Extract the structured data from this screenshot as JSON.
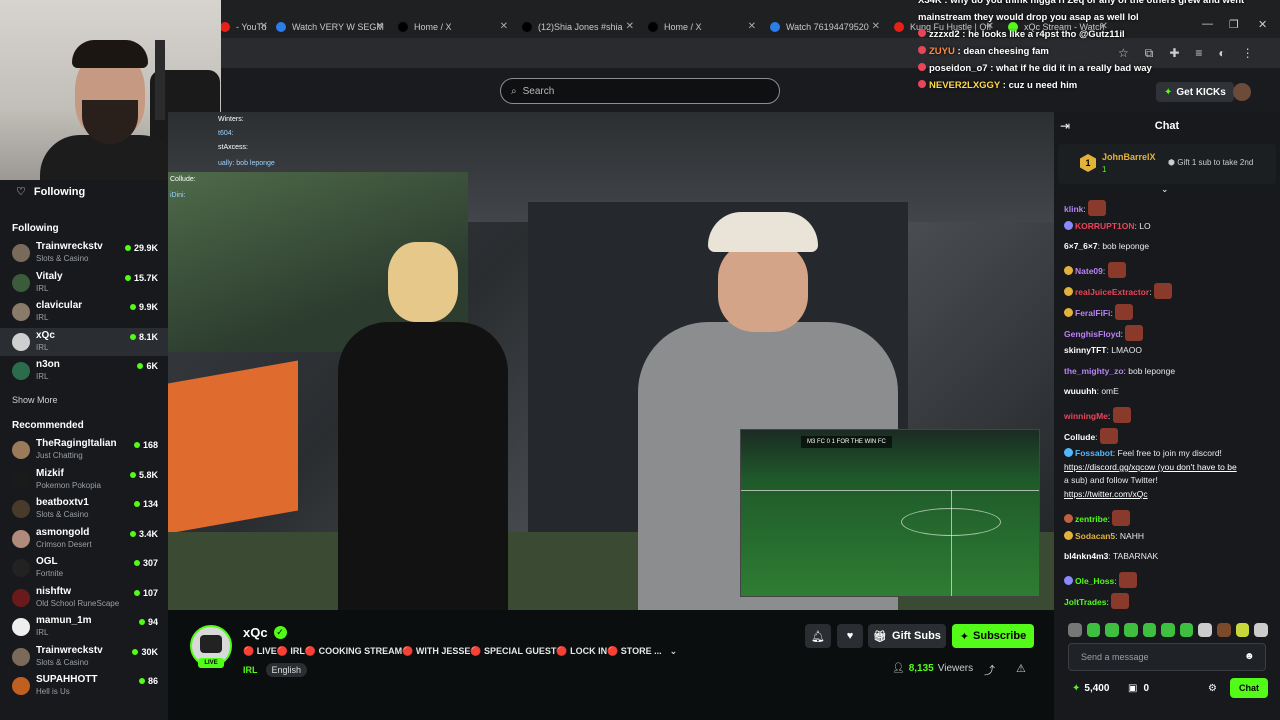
{
  "browser": {
    "tabs": [
      {
        "label": "- YouTu",
        "icon": "youtube-icon",
        "color": "#e62117"
      },
      {
        "label": "Watch VERY W SEGM",
        "icon": "site-icon",
        "color": "#2b7de9"
      },
      {
        "label": "Home / X",
        "icon": "x-icon",
        "color": "#000000"
      },
      {
        "label": "(12)Shia Jones #shia",
        "icon": "tiktok-icon",
        "color": "#000000"
      },
      {
        "label": "Home / X",
        "icon": "x-icon",
        "color": "#000000"
      },
      {
        "label": "Watch 76194479520",
        "icon": "site-icon",
        "color": "#2b7de9"
      },
      {
        "label": "Kung Fu Hustle | Off",
        "icon": "youtube-icon",
        "color": "#e62117"
      },
      {
        "label": "xQc Stream - Watch",
        "icon": "kick-icon",
        "color": "#53fc18"
      }
    ]
  },
  "header": {
    "search_placeholder": "Search",
    "get_kicks": "Get KICKs"
  },
  "external_chat": [
    {
      "text": "X34K : why do you think nigga ri Zeq or any of the others grew and went"
    },
    {
      "text": "mainstream they would drop you asap as well lol"
    },
    {
      "user": "zzzxd2",
      "msg": "he looks like a r4pst tho @Gutz11il"
    },
    {
      "user": "ZUYU",
      "msg": "dean cheesing fam"
    },
    {
      "user": "poseidon_o7",
      "msg": "what if he did it in a really bad way"
    },
    {
      "user": "NEVER2LXGGY",
      "msg": "cuz u need him"
    }
  ],
  "sidebar": {
    "following_header": "Following",
    "following_section": "Following",
    "following": [
      {
        "name": "Trainwreckstv",
        "category": "Slots & Casino",
        "viewers": "29.9K",
        "color": "#7a6a5a"
      },
      {
        "name": "Vitaly",
        "category": "IRL",
        "viewers": "15.7K",
        "color": "#3b5b3b"
      },
      {
        "name": "clavicular",
        "category": "IRL",
        "viewers": "9.9K",
        "color": "#8a7a6a"
      },
      {
        "name": "xQc",
        "category": "IRL",
        "viewers": "8.1K",
        "color": "#cfcfcf",
        "active": true
      },
      {
        "name": "n3on",
        "category": "IRL",
        "viewers": "6K",
        "color": "#2c6c4c"
      }
    ],
    "show_more": "Show More",
    "recommended_section": "Recommended",
    "recommended": [
      {
        "name": "TheRagingItalian",
        "category": "Just Chatting",
        "viewers": "168",
        "color": "#9a7a5a"
      },
      {
        "name": "Mizkif",
        "category": "Pokemon Pokopia",
        "viewers": "5.8K",
        "color": "#1a1a1a"
      },
      {
        "name": "beatboxtv1",
        "category": "Slots & Casino",
        "viewers": "134",
        "color": "#4a3a2a"
      },
      {
        "name": "asmongold",
        "category": "Crimson Desert",
        "viewers": "3.4K",
        "color": "#b08a7a"
      },
      {
        "name": "OGL",
        "category": "Fortnite",
        "viewers": "307",
        "color": "#222222"
      },
      {
        "name": "nishftw",
        "category": "Old School RuneScape",
        "viewers": "107",
        "color": "#6a1a1a"
      },
      {
        "name": "mamun_1m",
        "category": "IRL",
        "viewers": "94",
        "color": "#eeeeee"
      },
      {
        "name": "Trainwreckstv",
        "category": "Slots & Casino",
        "viewers": "30K",
        "color": "#7a6a5a"
      },
      {
        "name": "SUPAHHOTT",
        "category": "Hell is Us",
        "viewers": "86",
        "color": "#c06020"
      }
    ]
  },
  "video": {
    "overlay_chat": [
      "Winters:",
      "t604:",
      "stAxcess:",
      "ually: bob leponge",
      "Collude:",
      "iDini:"
    ],
    "pip_score": "M3 FC 0 1 FOR THE WIN FC"
  },
  "stream": {
    "channel": "xQc",
    "live": "LIVE",
    "title": "🔴 LIVE🔴 IRL🔴 COOKING STREAM🔴 WITH JESSE🔴 SPECIAL GUEST🔴 LOCK IN🔴 STORE ...",
    "category": "IRL",
    "language": "English",
    "gift_subs": "Gift Subs",
    "subscribe": "Subscribe",
    "viewers_count": "8,135",
    "viewers_label": "Viewers"
  },
  "chat": {
    "title": "Chat",
    "pinned": {
      "user": "JohnBarrelX",
      "rank": "1",
      "sub": "1",
      "gift_text": "Gift 1 sub to take 2nd"
    },
    "messages": [
      {
        "user": "klink",
        "color": "#b982f5",
        "msg": "",
        "emote": true
      },
      {
        "user": "KORRUPT1ON",
        "color": "#e8455a",
        "msg": "LO",
        "badge": "#8a8aff"
      },
      {
        "user": "6×7_6×7",
        "color": "#ffffff",
        "msg": "bob leponge"
      },
      {
        "user": "Nate09",
        "color": "#b982f5",
        "msg": "",
        "emote": true,
        "badge": "#e2b23b"
      },
      {
        "user": "realJuiceExtractor",
        "color": "#e8455a",
        "msg": "",
        "emote": true,
        "badge": "#e2b23b"
      },
      {
        "user": "FeralFiFi",
        "color": "#b982f5",
        "msg": "",
        "emote": true,
        "badge": "#e2b23b"
      },
      {
        "user": "GenghisFloyd",
        "color": "#b982f5",
        "msg": "",
        "emote": true
      },
      {
        "user": "skinnyTFT",
        "color": "#ffffff",
        "msg": "LMAOO"
      },
      {
        "user": "the_mighty_zo",
        "color": "#b982f5",
        "msg": "bob leponge"
      },
      {
        "user": "wuuuhh",
        "color": "#ffffff",
        "msg": "omE"
      },
      {
        "user": "winningMe",
        "color": "#e8455a",
        "msg": "",
        "emote": true
      },
      {
        "user": "Collude",
        "color": "#ffffff",
        "msg": "",
        "emote": true
      },
      {
        "user": "Fossabot",
        "color": "#53b7fc",
        "msg": "Feel free to join my discord!",
        "badge": "#53b7fc"
      },
      {
        "user": "",
        "color": "#ffffff",
        "msg": "https://discord.gg/xqcow (you don't have to be"
      },
      {
        "user": "",
        "color": "#ffffff",
        "msg": "a sub) and follow Twitter!"
      },
      {
        "user": "",
        "color": "#ffffff",
        "msg": "https://twitter.com/xQc"
      },
      {
        "user": "zentribe",
        "color": "#53fc18",
        "msg": "",
        "emote": true,
        "badge": "#c06040"
      },
      {
        "user": "Sodacan5",
        "color": "#e2b23b",
        "msg": "NAHH",
        "badge": "#e2b23b"
      },
      {
        "user": "bl4nkn4m3",
        "color": "#ffffff",
        "msg": "TABARNAK"
      },
      {
        "user": "Ole_Hoss",
        "color": "#53fc18",
        "msg": "",
        "emote": true,
        "badge": "#8a8aff"
      },
      {
        "user": "JoltTrades",
        "color": "#53fc18",
        "msg": "",
        "emote": true
      }
    ],
    "input_placeholder": "Send a message",
    "kicks": "5,400",
    "gifts": "0",
    "chat_button": "Chat"
  }
}
